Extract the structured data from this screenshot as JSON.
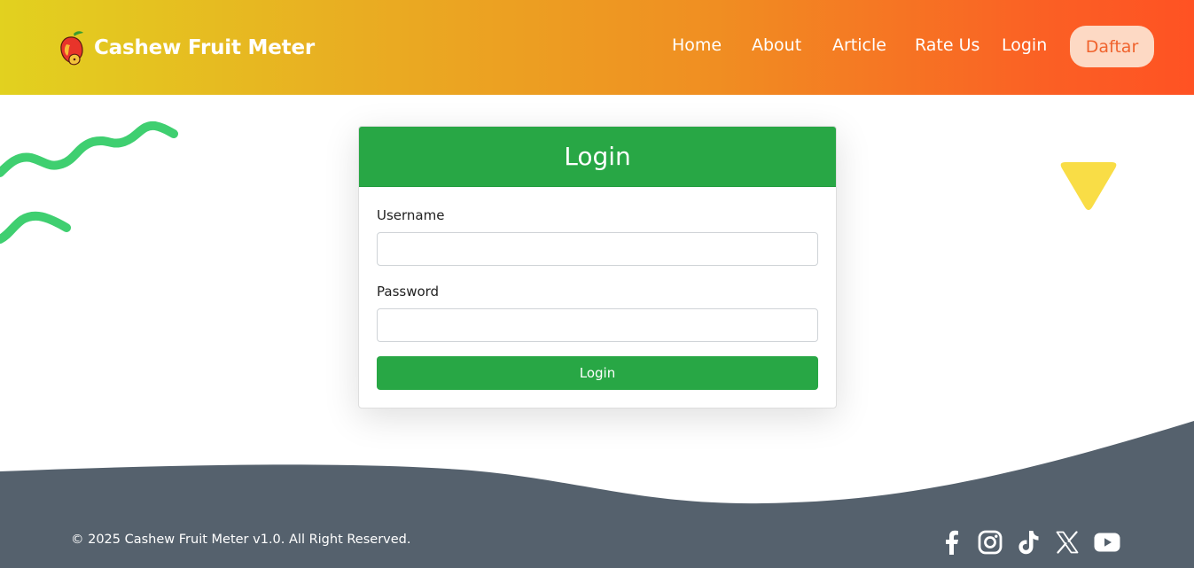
{
  "brand": {
    "name": "Cashew Fruit Meter",
    "logo_icon": "cashew-fruit-logo",
    "colors": {
      "gradient_start": "#e2d11f",
      "gradient_end": "#ff5223"
    }
  },
  "nav": {
    "links": [
      "Home",
      "About",
      "Article",
      "Rate Us",
      "Login"
    ],
    "cta_label": "Daftar"
  },
  "login_card": {
    "title": "Login",
    "username_label": "Username",
    "username_value": "",
    "password_label": "Password",
    "password_value": "",
    "submit_label": "Login",
    "accent_color": "#28a745"
  },
  "decorations": {
    "squiggle_icon": "green-squiggle",
    "triangle_icon": "yellow-triangle"
  },
  "footer": {
    "copyright": "© 2025 Cashew Fruit Meter v1.0. All Right Reserved.",
    "background_color": "#55616d",
    "social_icons": [
      "facebook-icon",
      "instagram-icon",
      "tiktok-icon",
      "x-icon",
      "youtube-icon"
    ]
  }
}
